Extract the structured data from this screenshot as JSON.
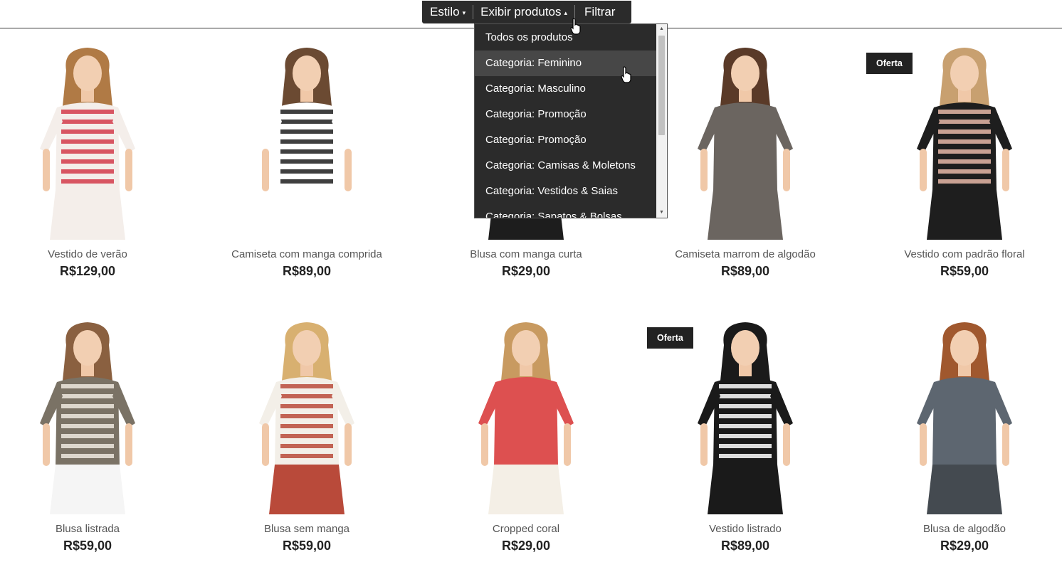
{
  "toolbar": {
    "style_label": "Estilo",
    "show_products_label": "Exibir produtos",
    "filter_label": "Filtrar"
  },
  "dropdown": {
    "items": [
      "Todos os produtos",
      "Categoria: Feminino",
      "Categoria: Masculino",
      "Categoria: Promoção",
      "Categoria: Promoção",
      "Categoria: Camisas & Moletons",
      "Categoria: Vestidos & Saias",
      "Categoria: Sapatos & Bolsas"
    ],
    "highlighted_index": 1
  },
  "badge_label": "Oferta",
  "products": [
    {
      "name": "Vestido de verão",
      "price": "R$129,00",
      "sale": false,
      "hair": "#b07a45",
      "top": "#f4eeea",
      "accent": "#d23a4a",
      "bottom": "#f4eeea"
    },
    {
      "name": "Camiseta com manga comprida",
      "price": "R$89,00",
      "sale": false,
      "hair": "#6b4a32",
      "top": "#ffffff",
      "accent": "#1d1d1d",
      "bottom": "#ffffff"
    },
    {
      "name": "Blusa com manga curta",
      "price": "R$29,00",
      "sale": false,
      "hair": "#3a2a20",
      "top": "#1d1d1d",
      "accent": "#1d1d1d",
      "bottom": "#1d1d1d"
    },
    {
      "name": "Camiseta marrom de algodão",
      "price": "R$89,00",
      "sale": false,
      "hair": "#5a3a28",
      "top": "#6b6560",
      "accent": "#6b6560",
      "bottom": "#6b6560"
    },
    {
      "name": "Vestido com padrão floral",
      "price": "R$59,00",
      "sale": true,
      "hair": "#c8a070",
      "top": "#1e1e1e",
      "accent": "#e8b8a8",
      "bottom": "#1e1e1e"
    },
    {
      "name": "Blusa listrada",
      "price": "R$59,00",
      "sale": false,
      "hair": "#8a6040",
      "top": "#7a7265",
      "accent": "#efe9df",
      "bottom": "#f5f5f5"
    },
    {
      "name": "Blusa sem manga",
      "price": "R$59,00",
      "sale": false,
      "hair": "#d8b070",
      "top": "#f3efe8",
      "accent": "#b94a3a",
      "bottom": "#b94a3a"
    },
    {
      "name": "Cropped coral",
      "price": "R$29,00",
      "sale": false,
      "hair": "#c89a60",
      "top": "#dd5050",
      "accent": "#dd5050",
      "bottom": "#f4efe6"
    },
    {
      "name": "Vestido listrado",
      "price": "R$89,00",
      "sale": true,
      "hair": "#1a1a1a",
      "top": "#1a1a1a",
      "accent": "#ffffff",
      "bottom": "#1a1a1a"
    },
    {
      "name": "Blusa de algodão",
      "price": "R$29,00",
      "sale": false,
      "hair": "#a0582e",
      "top": "#5d6670",
      "accent": "#5d6670",
      "bottom": "#444a50"
    }
  ]
}
